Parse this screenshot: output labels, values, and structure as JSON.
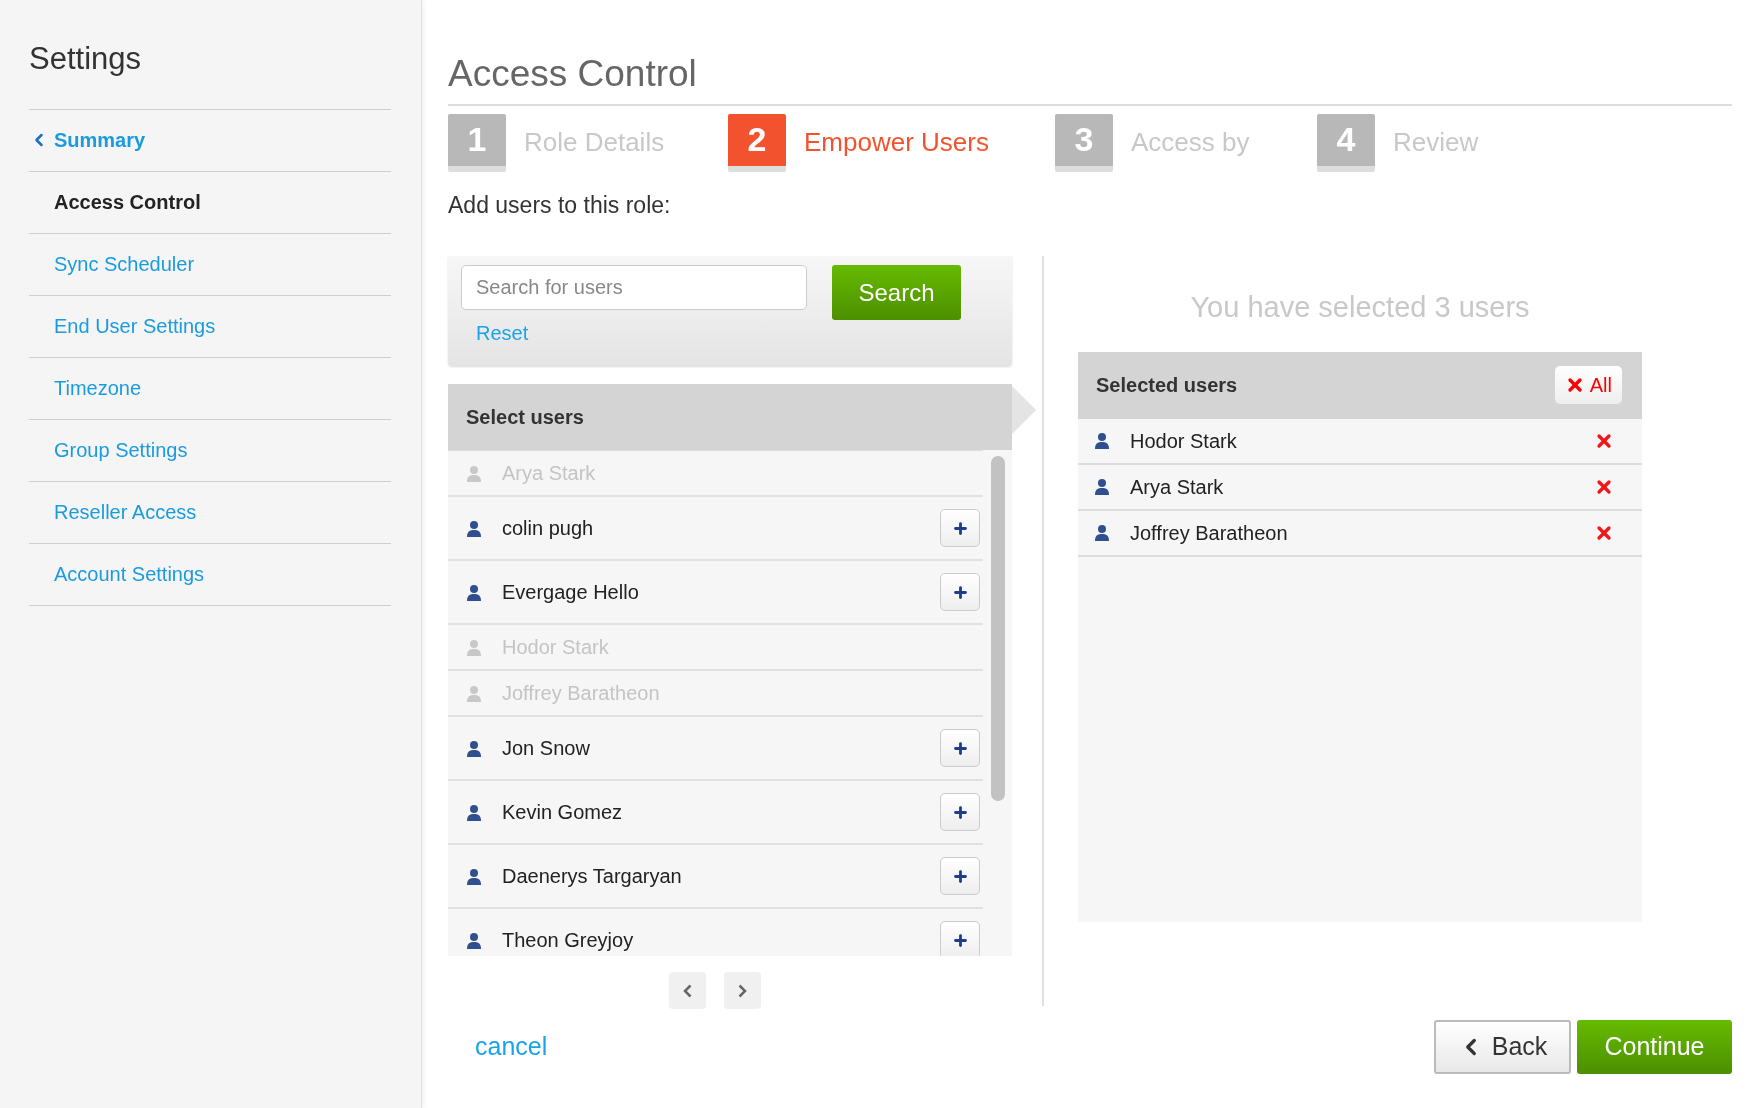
{
  "sidebar": {
    "title": "Settings",
    "items": [
      {
        "label": "Summary",
        "kind": "back",
        "selected": false
      },
      {
        "label": "Access Control",
        "kind": "item",
        "selected": true
      },
      {
        "label": "Sync Scheduler",
        "kind": "item",
        "selected": false
      },
      {
        "label": "End User Settings",
        "kind": "item",
        "selected": false
      },
      {
        "label": "Timezone",
        "kind": "item",
        "selected": false
      },
      {
        "label": "Group Settings",
        "kind": "item",
        "selected": false
      },
      {
        "label": "Reseller Access",
        "kind": "item",
        "selected": false
      },
      {
        "label": "Account Settings",
        "kind": "item",
        "selected": false
      }
    ]
  },
  "page_title": "Access Control",
  "steps": [
    {
      "number": "1",
      "label": "Role Details",
      "selected": false
    },
    {
      "number": "2",
      "label": "Empower Users",
      "selected": true
    },
    {
      "number": "3",
      "label": "Access by",
      "selected": false
    },
    {
      "number": "4",
      "label": "Review",
      "selected": false
    }
  ],
  "prompt": "Add users to this role:",
  "search": {
    "placeholder": "Search for users",
    "button": "Search",
    "reset": "Reset"
  },
  "select_users": {
    "title": "Select users",
    "users": [
      {
        "name": "Arya Stark",
        "disabled": true
      },
      {
        "name": "colin pugh",
        "disabled": false
      },
      {
        "name": "Evergage Hello",
        "disabled": false
      },
      {
        "name": "Hodor Stark",
        "disabled": true
      },
      {
        "name": "Joffrey Baratheon",
        "disabled": true
      },
      {
        "name": "Jon Snow",
        "disabled": false
      },
      {
        "name": "Kevin Gomez",
        "disabled": false
      },
      {
        "name": "Daenerys Targaryan",
        "disabled": false
      },
      {
        "name": "Theon Greyjoy",
        "disabled": false
      }
    ]
  },
  "selected_users": {
    "summary": "You have selected 3 users",
    "title": "Selected users",
    "clear_all": "All",
    "users": [
      {
        "name": "Hodor Stark"
      },
      {
        "name": "Arya Stark"
      },
      {
        "name": "Joffrey Baratheon"
      }
    ]
  },
  "footer": {
    "cancel": "cancel",
    "back": "Back",
    "continue": "Continue"
  }
}
